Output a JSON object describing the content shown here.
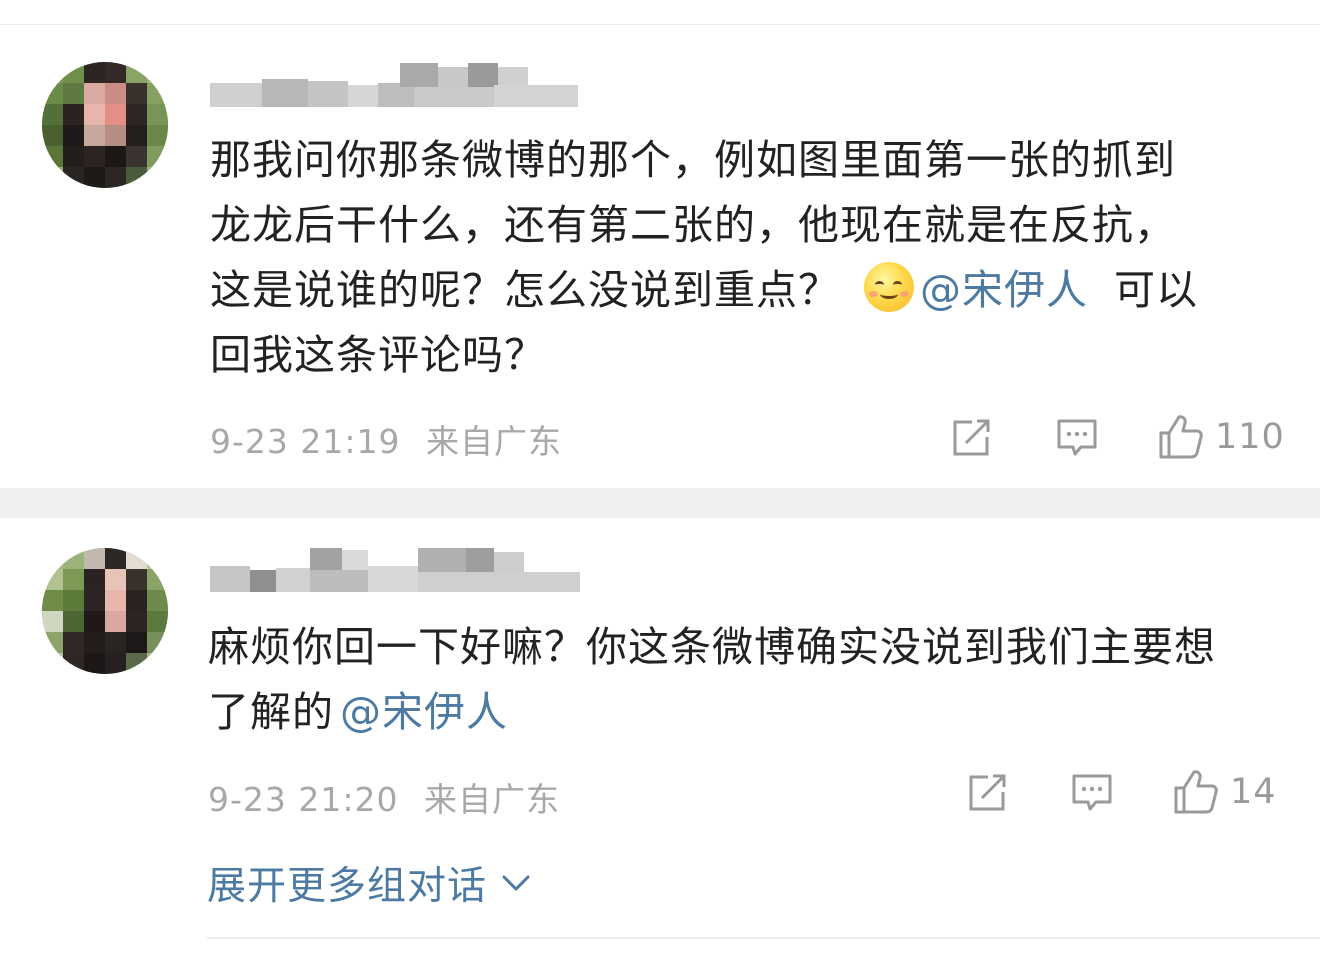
{
  "comments": [
    {
      "text_lines": [
        "那我问你那条微博的那个，例如图里面第一张的抓到",
        "龙龙后干什么，还有第二张的，他现在就是在反抗，",
        "这是说谁的呢？怎么没说到重点？"
      ],
      "mention": "@宋伊人",
      "text_after_mention": "可以",
      "last_line": "回我这条评论吗？",
      "emoji": "smiling-face-emoji",
      "time": "9-23 21:19",
      "location": "来自广东",
      "likes": "110"
    },
    {
      "text_lines": [
        "麻烦你回一下好嘛？你这条微博确实没说到我们主要想",
        "了解的"
      ],
      "mention": "@宋伊人",
      "time": "9-23 21:20",
      "location": "来自广东",
      "likes": "14"
    }
  ],
  "expand_label": "展开更多组对话",
  "icons": {
    "share": "share-icon",
    "comment": "comment-icon",
    "like": "thumbs-up-icon",
    "expand": "chevron-down-icon"
  },
  "colors": {
    "mention": "#4c7aa3",
    "meta": "#a8a8a8",
    "separator": "#f0f0f0"
  }
}
